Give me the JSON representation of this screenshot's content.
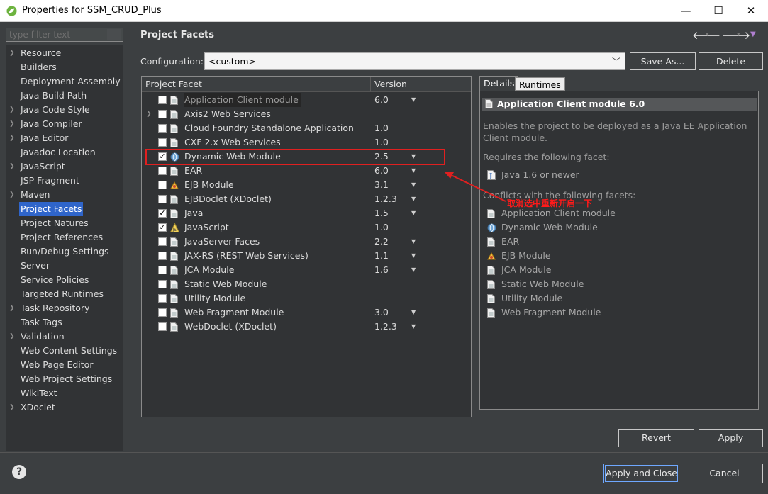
{
  "window": {
    "title": "Properties for SSM_CRUD_Plus",
    "minimize": "—",
    "maximize": "☐",
    "close": "✕"
  },
  "sidebar": {
    "filter_placeholder": "type filter text",
    "items": [
      {
        "label": "Resource",
        "expandable": true
      },
      {
        "label": "Builders",
        "expandable": false
      },
      {
        "label": "Deployment Assembly",
        "expandable": false
      },
      {
        "label": "Java Build Path",
        "expandable": false
      },
      {
        "label": "Java Code Style",
        "expandable": true
      },
      {
        "label": "Java Compiler",
        "expandable": true
      },
      {
        "label": "Java Editor",
        "expandable": true
      },
      {
        "label": "Javadoc Location",
        "expandable": false
      },
      {
        "label": "JavaScript",
        "expandable": true
      },
      {
        "label": "JSP Fragment",
        "expandable": false
      },
      {
        "label": "Maven",
        "expandable": true
      },
      {
        "label": "Project Facets",
        "expandable": false,
        "selected": true
      },
      {
        "label": "Project Natures",
        "expandable": false
      },
      {
        "label": "Project References",
        "expandable": false
      },
      {
        "label": "Run/Debug Settings",
        "expandable": false
      },
      {
        "label": "Server",
        "expandable": false
      },
      {
        "label": "Service Policies",
        "expandable": false
      },
      {
        "label": "Targeted Runtimes",
        "expandable": false
      },
      {
        "label": "Task Repository",
        "expandable": true
      },
      {
        "label": "Task Tags",
        "expandable": false
      },
      {
        "label": "Validation",
        "expandable": true
      },
      {
        "label": "Web Content Settings",
        "expandable": false
      },
      {
        "label": "Web Page Editor",
        "expandable": false
      },
      {
        "label": "Web Project Settings",
        "expandable": false
      },
      {
        "label": "WikiText",
        "expandable": false
      },
      {
        "label": "XDoclet",
        "expandable": true
      }
    ]
  },
  "header": {
    "title": "Project Facets",
    "back_icon": "back-arrow-icon",
    "forward_icon": "forward-arrow-icon",
    "menu_icon": "view-menu-icon"
  },
  "configuration": {
    "label": "Configuration:",
    "value": "<custom>",
    "save_as": "Save As...",
    "delete": "Delete"
  },
  "facets": {
    "col_facet": "Project Facet",
    "col_version": "Version",
    "rows": [
      {
        "name": "Application Client module",
        "version": "6.0",
        "checked": false,
        "expandable": false,
        "dropdown": true,
        "highlighted": true
      },
      {
        "name": "Axis2 Web Services",
        "version": "",
        "checked": false,
        "expandable": true,
        "dropdown": false
      },
      {
        "name": "Cloud Foundry Standalone Application",
        "version": "1.0",
        "checked": false,
        "expandable": false,
        "dropdown": false
      },
      {
        "name": "CXF 2.x Web Services",
        "version": "1.0",
        "checked": false,
        "expandable": false,
        "dropdown": false
      },
      {
        "name": "Dynamic Web Module",
        "version": "2.5",
        "checked": true,
        "expandable": false,
        "dropdown": true
      },
      {
        "name": "EAR",
        "version": "6.0",
        "checked": false,
        "expandable": false,
        "dropdown": true
      },
      {
        "name": "EJB Module",
        "version": "3.1",
        "checked": false,
        "expandable": false,
        "dropdown": true
      },
      {
        "name": "EJBDoclet (XDoclet)",
        "version": "1.2.3",
        "checked": false,
        "expandable": false,
        "dropdown": true
      },
      {
        "name": "Java",
        "version": "1.5",
        "checked": true,
        "expandable": false,
        "dropdown": true
      },
      {
        "name": "JavaScript",
        "version": "1.0",
        "checked": true,
        "expandable": false,
        "dropdown": false
      },
      {
        "name": "JavaServer Faces",
        "version": "2.2",
        "checked": false,
        "expandable": false,
        "dropdown": true
      },
      {
        "name": "JAX-RS (REST Web Services)",
        "version": "1.1",
        "checked": false,
        "expandable": false,
        "dropdown": true
      },
      {
        "name": "JCA Module",
        "version": "1.6",
        "checked": false,
        "expandable": false,
        "dropdown": true
      },
      {
        "name": "Static Web Module",
        "version": "",
        "checked": false,
        "expandable": false,
        "dropdown": false
      },
      {
        "name": "Utility Module",
        "version": "",
        "checked": false,
        "expandable": false,
        "dropdown": false
      },
      {
        "name": "Web Fragment Module",
        "version": "3.0",
        "checked": false,
        "expandable": false,
        "dropdown": true
      },
      {
        "name": "WebDoclet (XDoclet)",
        "version": "1.2.3",
        "checked": false,
        "expandable": false,
        "dropdown": true
      }
    ]
  },
  "details": {
    "tab_details": "Details",
    "tab_runtimes": "Runtimes",
    "title": "Application Client module 6.0",
    "description_line1": "Enables the project to be deployed as a Java EE Application",
    "description_line2": "Client module.",
    "requires_label": "Requires the following facet:",
    "requires": [
      "Java 1.6 or newer"
    ],
    "conflicts_label": "Conflicts with the following facets:",
    "conflicts": [
      "Application Client module",
      "Dynamic Web Module",
      "EAR",
      "EJB Module",
      "JCA Module",
      "Static Web Module",
      "Utility Module",
      "Web Fragment Module"
    ]
  },
  "annotation": {
    "text": "取消选中重新开启一下",
    "color": "#ff1a1a"
  },
  "buttons": {
    "revert": "Revert",
    "apply": "Apply",
    "apply_close": "Apply and Close",
    "cancel": "Cancel"
  },
  "colors": {
    "background": "#3c3f41",
    "panel": "#313335",
    "selection": "#2f65ca",
    "annotation": "#e02020"
  }
}
